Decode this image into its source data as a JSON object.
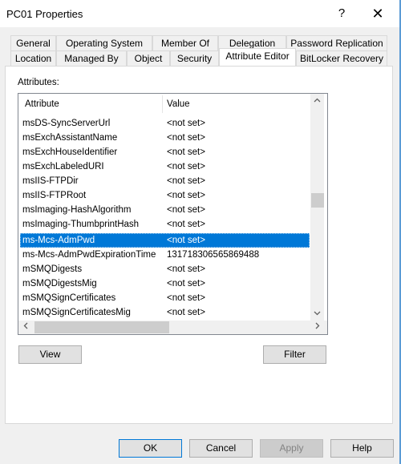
{
  "window": {
    "title": "PC01 Properties",
    "help_glyph": "?",
    "close_glyph": "✕"
  },
  "tabs_row1": [
    {
      "label": "General"
    },
    {
      "label": "Operating System"
    },
    {
      "label": "Member Of"
    },
    {
      "label": "Delegation"
    },
    {
      "label": "Password Replication"
    }
  ],
  "tabs_row2": [
    {
      "label": "Location"
    },
    {
      "label": "Managed By"
    },
    {
      "label": "Object"
    },
    {
      "label": "Security"
    },
    {
      "label": "Attribute Editor",
      "active": true
    },
    {
      "label": "BitLocker Recovery"
    }
  ],
  "attributes": {
    "label": "Attributes:",
    "columns": {
      "attribute": "Attribute",
      "value": "Value"
    },
    "rows": [
      {
        "attribute": "msDS-SyncServerUrl",
        "value": "<not set>"
      },
      {
        "attribute": "msExchAssistantName",
        "value": "<not set>"
      },
      {
        "attribute": "msExchHouseIdentifier",
        "value": "<not set>"
      },
      {
        "attribute": "msExchLabeledURI",
        "value": "<not set>"
      },
      {
        "attribute": "msIIS-FTPDir",
        "value": "<not set>"
      },
      {
        "attribute": "msIIS-FTPRoot",
        "value": "<not set>"
      },
      {
        "attribute": "msImaging-HashAlgorithm",
        "value": "<not set>"
      },
      {
        "attribute": "msImaging-ThumbprintHash",
        "value": "<not set>"
      },
      {
        "attribute": "ms-Mcs-AdmPwd",
        "value": "<not set>",
        "selected": true
      },
      {
        "attribute": "ms-Mcs-AdmPwdExpirationTime",
        "value": "131718306565869488"
      },
      {
        "attribute": "mSMQDigests",
        "value": "<not set>"
      },
      {
        "attribute": "mSMQDigestsMig",
        "value": "<not set>"
      },
      {
        "attribute": "mSMQSignCertificates",
        "value": "<not set>"
      },
      {
        "attribute": "mSMQSignCertificatesMig",
        "value": "<not set>"
      }
    ],
    "scroll": {
      "up": "^",
      "down": "v",
      "left": "<",
      "right": ">"
    },
    "selection_color": "#0078d7"
  },
  "buttons": {
    "view": "View",
    "filter": "Filter",
    "ok": "OK",
    "cancel": "Cancel",
    "apply": "Apply",
    "help": "Help"
  }
}
